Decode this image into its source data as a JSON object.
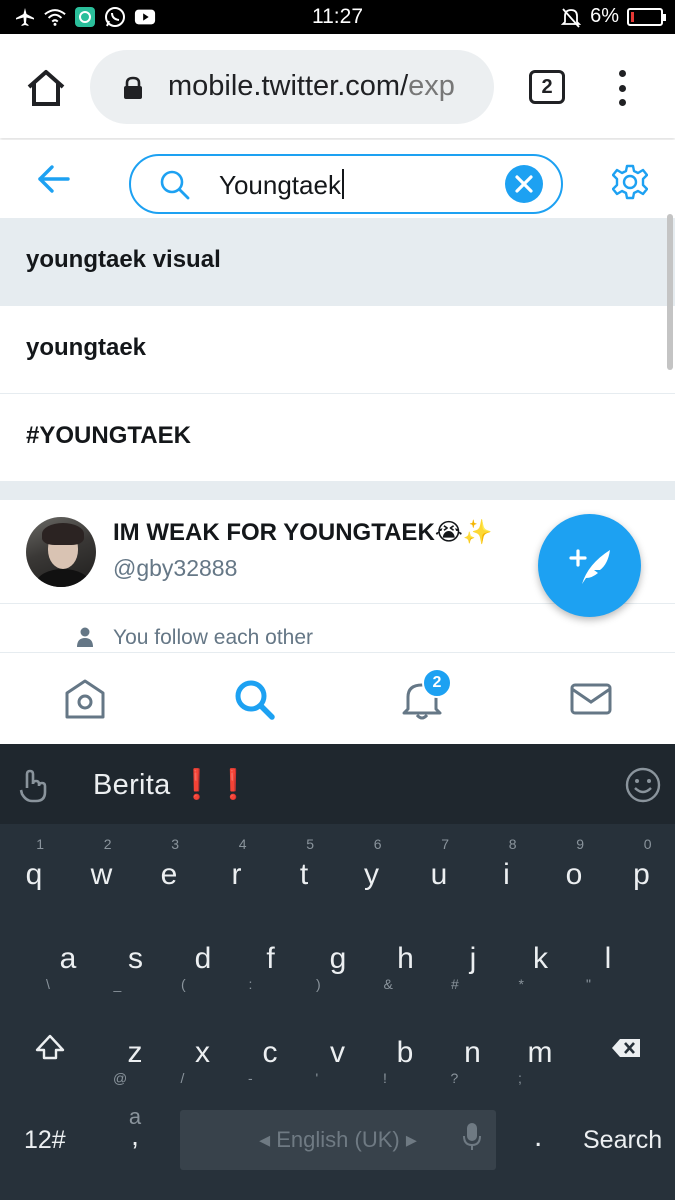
{
  "status_bar": {
    "time": "11:27",
    "battery_percent": "6%",
    "icons": [
      "airplane-icon",
      "wifi-icon",
      "app-icon",
      "whatsapp-icon",
      "youtube-icon",
      "muted-bell-icon",
      "battery-icon"
    ]
  },
  "browser": {
    "url_host": "mobile.twitter.com/",
    "url_path_visible": "exp",
    "tab_count": "2"
  },
  "search": {
    "query": "Youngtaek"
  },
  "suggestions": [
    {
      "label": "youngtaek visual"
    },
    {
      "label": "youngtaek"
    },
    {
      "label": "#YOUNGTAEK"
    }
  ],
  "user_result": {
    "name": "IM WEAK FOR YOUNGTAEK😭✨",
    "handle": "@gby32888",
    "relation": "You follow each other"
  },
  "tab_bar": {
    "notifications_badge": "2"
  },
  "keyboard": {
    "suggestion_word": "Berita",
    "suggestion_emoji": "❗❗",
    "row1": [
      {
        "k": "q",
        "s": "1"
      },
      {
        "k": "w",
        "s": "2"
      },
      {
        "k": "e",
        "s": "3"
      },
      {
        "k": "r",
        "s": "4"
      },
      {
        "k": "t",
        "s": "5"
      },
      {
        "k": "y",
        "s": "6"
      },
      {
        "k": "u",
        "s": "7"
      },
      {
        "k": "i",
        "s": "8"
      },
      {
        "k": "o",
        "s": "9"
      },
      {
        "k": "p",
        "s": "0"
      }
    ],
    "row2": [
      {
        "k": "a",
        "s": "\\"
      },
      {
        "k": "s",
        "s": "_"
      },
      {
        "k": "d",
        "s": "("
      },
      {
        "k": "f",
        "s": ":"
      },
      {
        "k": "g",
        "s": ")"
      },
      {
        "k": "h",
        "s": "&"
      },
      {
        "k": "j",
        "s": "#"
      },
      {
        "k": "k",
        "s": "*"
      },
      {
        "k": "l",
        "s": "\""
      }
    ],
    "row3": [
      {
        "k": "z",
        "s": "@"
      },
      {
        "k": "x",
        "s": "/"
      },
      {
        "k": "c",
        "s": "-"
      },
      {
        "k": "v",
        "s": "'"
      },
      {
        "k": "b",
        "s": "!"
      },
      {
        "k": "n",
        "s": "?"
      },
      {
        "k": "m",
        "s": ";"
      }
    ],
    "mode_key": "12#",
    "comma_alt": "a",
    "comma_key": ",",
    "space_label": "English (UK)",
    "period_key": ".",
    "action_key": "Search"
  }
}
